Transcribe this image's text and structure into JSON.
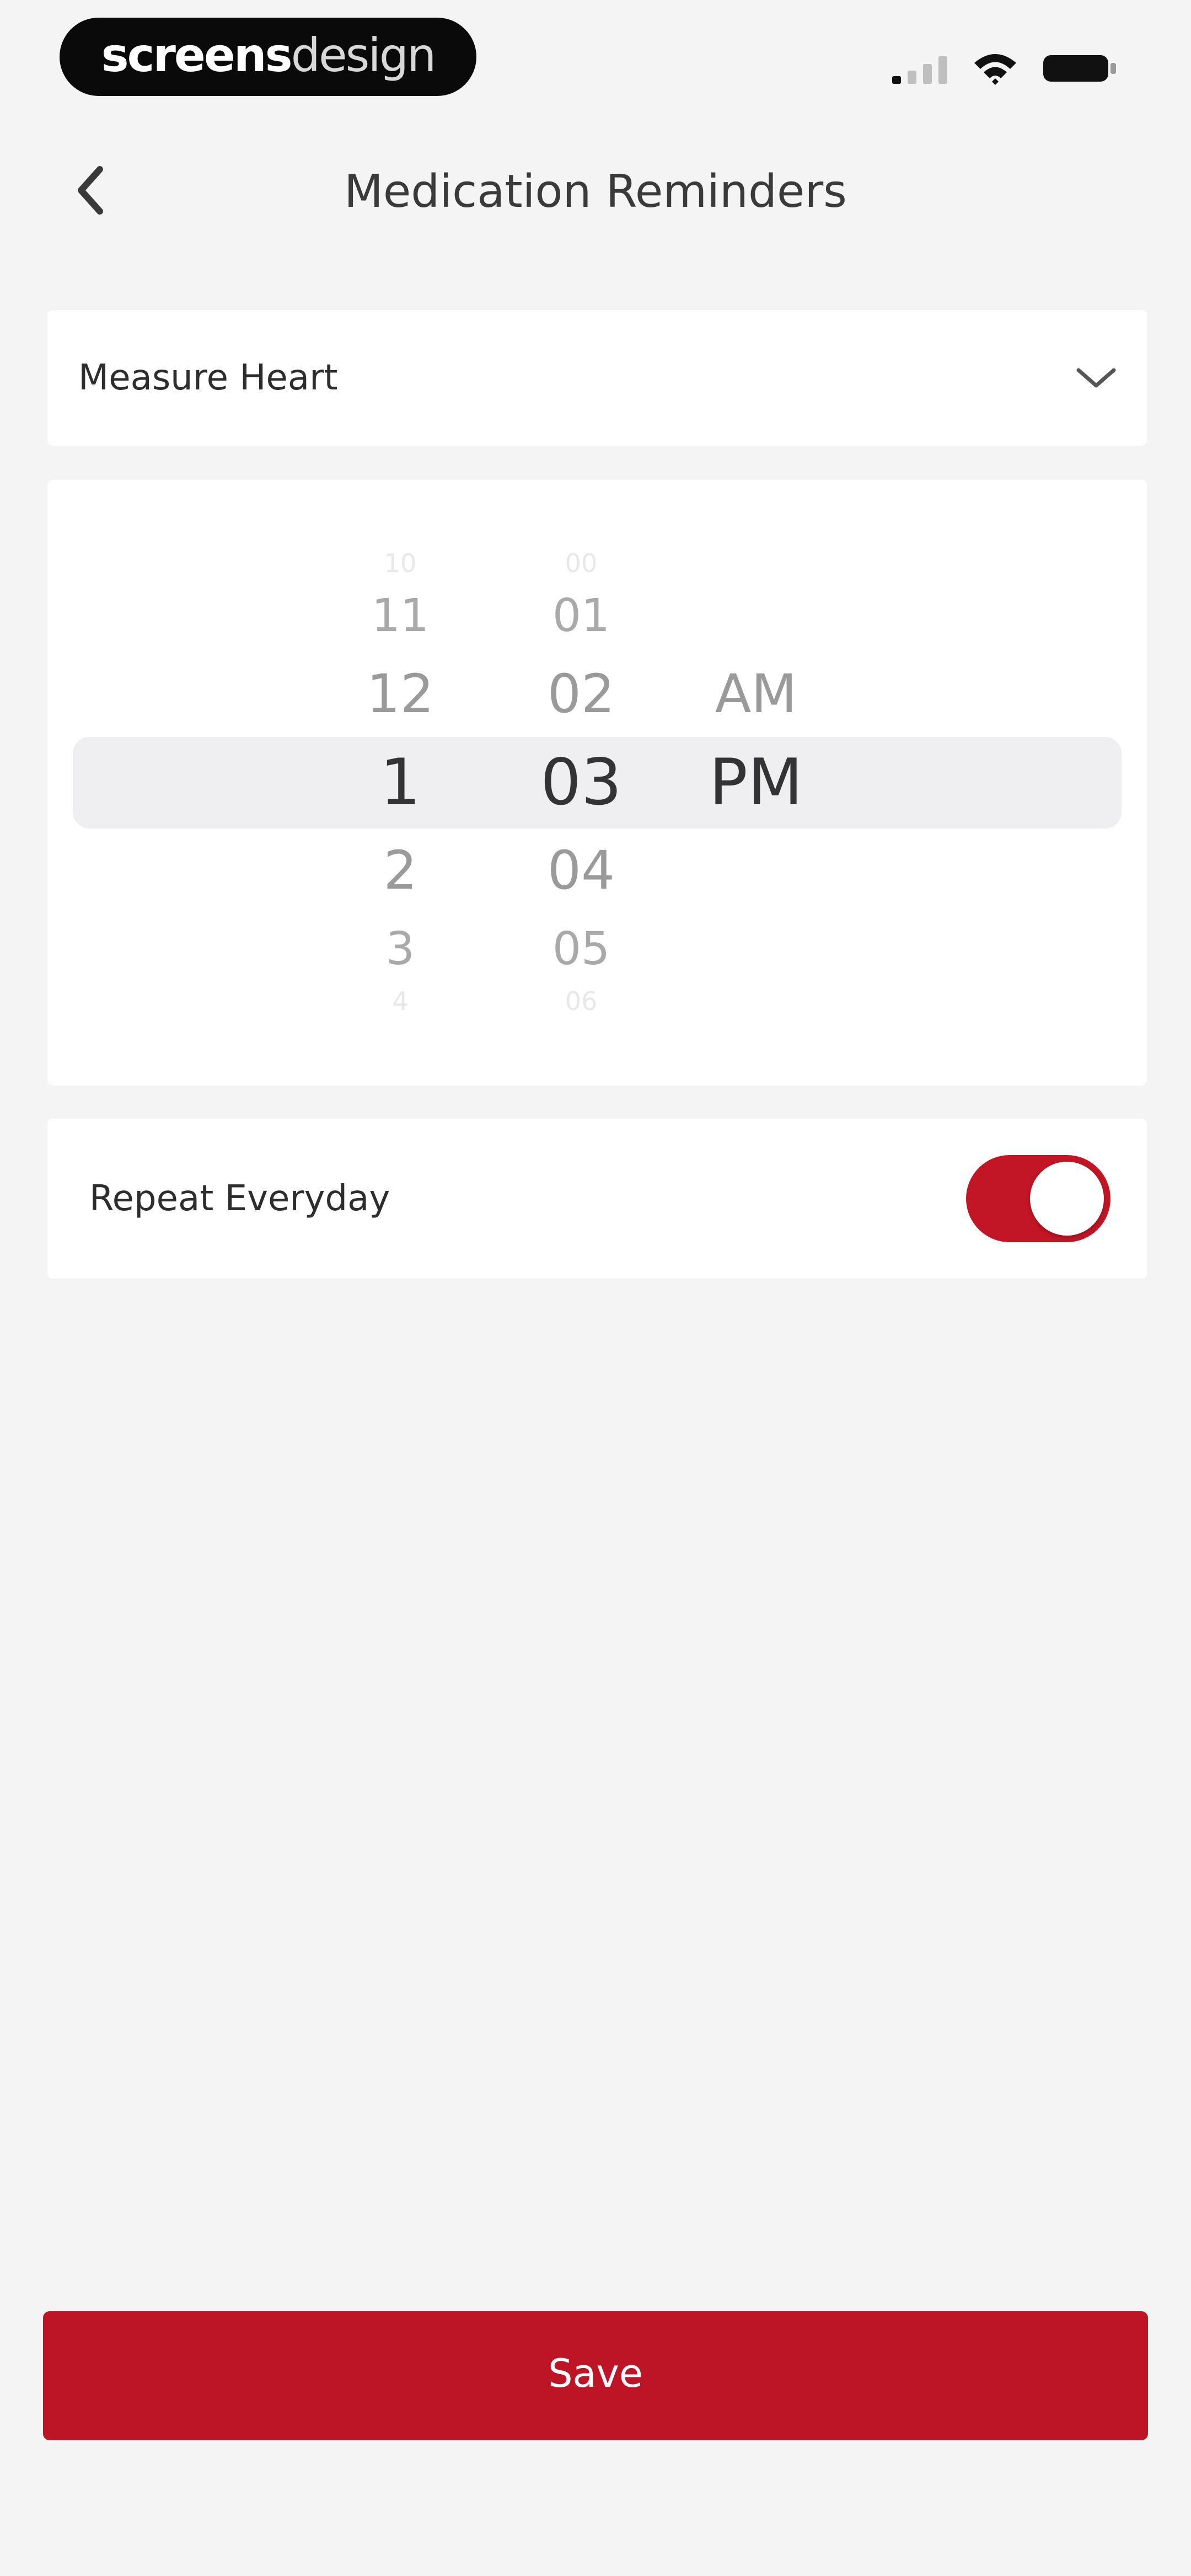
{
  "status_bar": {
    "brand_prefix": "screens",
    "brand_suffix": "design"
  },
  "nav": {
    "title": "Medication Reminders"
  },
  "reminder_select": {
    "selected": "Measure Heart"
  },
  "time_picker": {
    "hours": [
      "10",
      "11",
      "12",
      "1",
      "2",
      "3",
      "4"
    ],
    "minutes": [
      "00",
      "01",
      "02",
      "03",
      "04",
      "05",
      "06"
    ],
    "periods": [
      "AM",
      "PM"
    ],
    "selected_hour": "1",
    "selected_minute": "03",
    "selected_period": "PM"
  },
  "repeat": {
    "label": "Repeat Everyday",
    "enabled": true
  },
  "actions": {
    "save_label": "Save"
  },
  "colors": {
    "accent": "#bd1426",
    "background": "#f4f4f4",
    "card": "#ffffff",
    "picker_highlight": "#efeff1"
  }
}
